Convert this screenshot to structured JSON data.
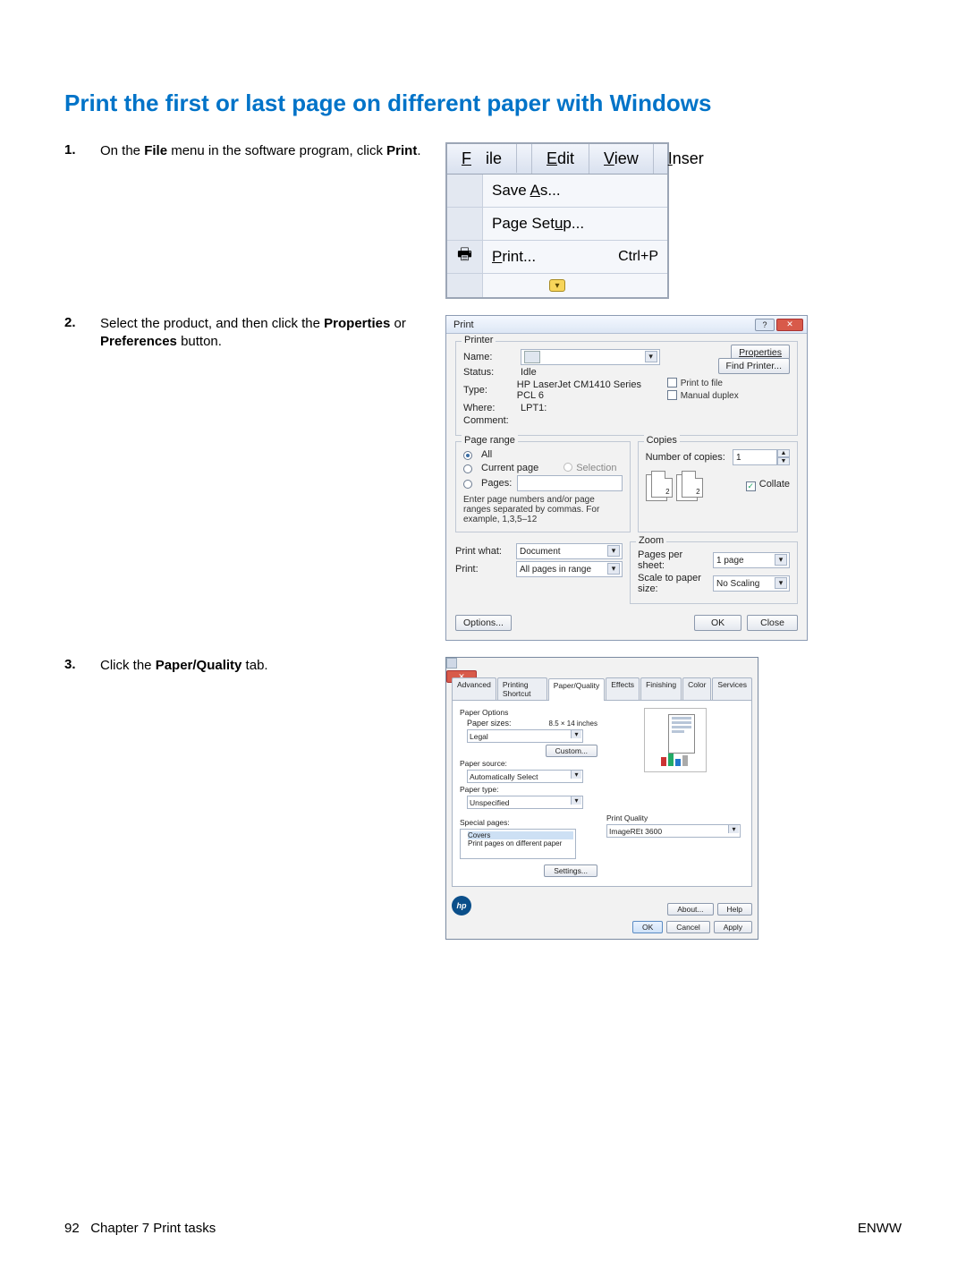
{
  "title": "Print the first or last page on different paper with Windows",
  "steps": {
    "s1": {
      "num": "1.",
      "pre": "On the ",
      "b1": "File",
      "mid": " menu in the software program, click ",
      "b2": "Print",
      "post": "."
    },
    "s2": {
      "num": "2.",
      "pre": "Select the product, and then click the ",
      "b1": "Properties",
      "mid": " or ",
      "b2": "Preferences",
      "post": " button."
    },
    "s3": {
      "num": "3.",
      "pre": "Click the ",
      "b1": "Paper/Quality",
      "post": " tab."
    }
  },
  "menu": {
    "bar": {
      "file": "File",
      "edit": "Edit",
      "view": "View",
      "inser": "Inser"
    },
    "items": {
      "saveas": "Save As...",
      "pagesetup": "Page Setup...",
      "print": "Print...",
      "shortcut": "Ctrl+P"
    }
  },
  "printdlg": {
    "title": "Print",
    "printer_grp": "Printer",
    "name": "Name:",
    "status": "Status:",
    "status_v": "Idle",
    "type": "Type:",
    "type_v": "HP LaserJet CM1410 Series PCL 6",
    "where": "Where:",
    "where_v": "LPT1:",
    "comment": "Comment:",
    "properties": "Properties",
    "find": "Find Printer...",
    "print_to_file": "Print to file",
    "manual_duplex": "Manual duplex",
    "pagerange_grp": "Page range",
    "all": "All",
    "current": "Current page",
    "selection": "Selection",
    "pages": "Pages:",
    "hint": "Enter page numbers and/or page ranges separated by commas.  For example, 1,3,5–12",
    "copies_grp": "Copies",
    "numcopies": "Number of copies:",
    "copies_v": "1",
    "collate": "Collate",
    "printwhat": "Print what:",
    "printwhat_v": "Document",
    "print": "Print:",
    "print_v": "All pages in range",
    "zoom_grp": "Zoom",
    "pps": "Pages per sheet:",
    "pps_v": "1 page",
    "scale": "Scale to paper size:",
    "scale_v": "No Scaling",
    "options": "Options...",
    "ok": "OK",
    "close": "Close"
  },
  "props": {
    "tabs": {
      "adv": "Advanced",
      "short": "Printing Shortcut",
      "pq": "Paper/Quality",
      "eff": "Effects",
      "fin": "Finishing",
      "col": "Color",
      "serv": "Services"
    },
    "paper_options": "Paper Options",
    "paper_sizes": "Paper sizes:",
    "paper_dim": "8.5 × 14 inches",
    "size_v": "Legal",
    "custom": "Custom...",
    "paper_source": "Paper source:",
    "source_v": "Automatically Select",
    "paper_type": "Paper type:",
    "type_v": "Unspecified",
    "special": "Special pages:",
    "covers": "Covers",
    "diff": "Print pages on different paper",
    "settings": "Settings...",
    "pq_grp": "Print Quality",
    "pq_v": "ImageREt 3600",
    "about": "About...",
    "help": "Help",
    "ok": "OK",
    "cancel": "Cancel",
    "apply": "Apply"
  },
  "footer": {
    "pagenum": "92",
    "chapter": "Chapter 7   Print tasks",
    "right": "ENWW"
  }
}
